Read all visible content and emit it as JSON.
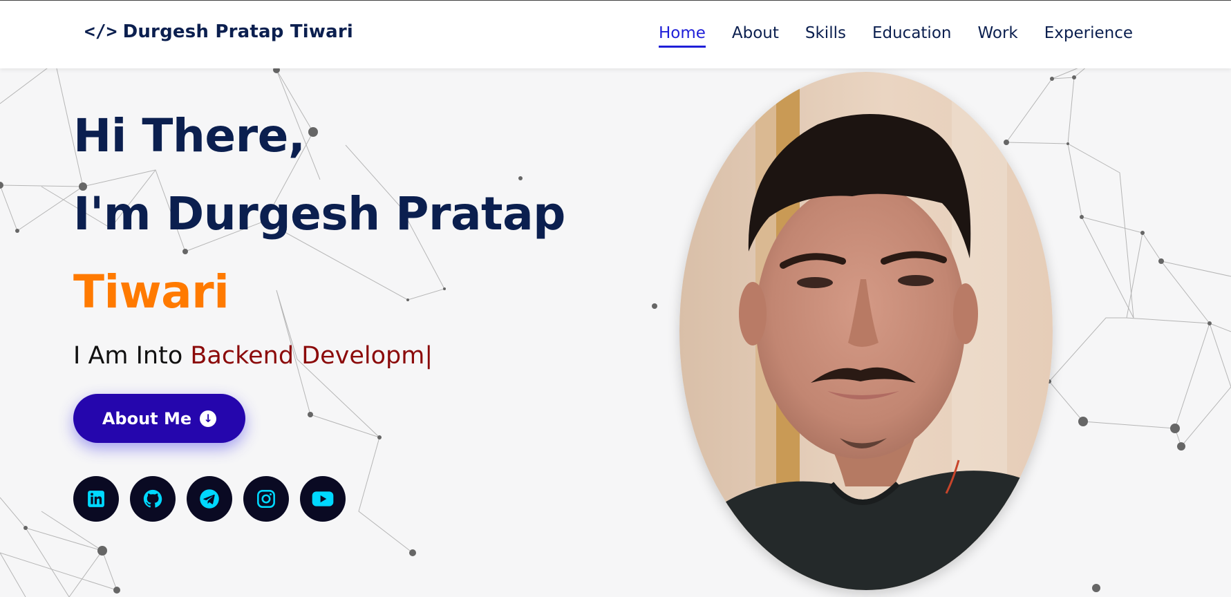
{
  "header": {
    "brand_icon": "</>",
    "brand_name": "Durgesh Pratap Tiwari",
    "nav": [
      {
        "label": "Home",
        "active": true
      },
      {
        "label": "About",
        "active": false
      },
      {
        "label": "Skills",
        "active": false
      },
      {
        "label": "Education",
        "active": false
      },
      {
        "label": "Work",
        "active": false
      },
      {
        "label": "Experience",
        "active": false
      }
    ]
  },
  "hero": {
    "line1": "Hi There,",
    "line2": "I'm Durgesh Pratap",
    "line3": "Tiwari",
    "typed_prefix": "I Am Into",
    "typed_text": "Backend Developm|",
    "button_label": "About Me"
  },
  "socials": [
    "linkedin-icon",
    "github-icon",
    "telegram-icon",
    "instagram-icon",
    "youtube-icon"
  ],
  "colors": {
    "heading": "#0b1f4f",
    "accent_orange": "#ff7a00",
    "typed_red": "#8b0a0a",
    "button_bg": "#2506ad",
    "nav_active": "#1f1fd8",
    "social_bg": "#0a0a23",
    "social_icon": "#00d8ff"
  }
}
